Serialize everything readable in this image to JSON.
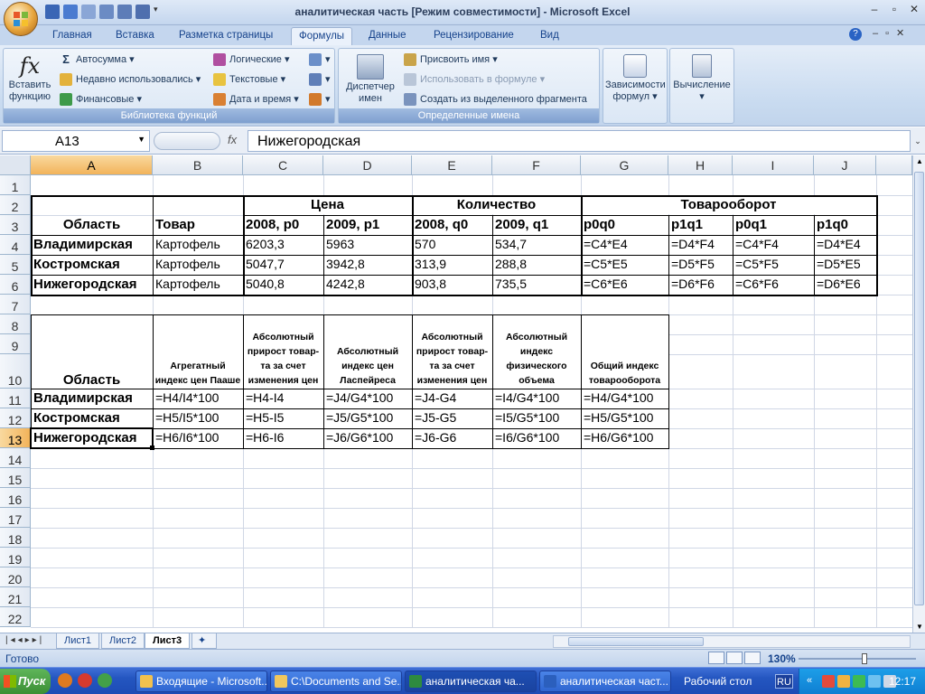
{
  "window": {
    "title": "аналитическая часть  [Режим совместимости] - Microsoft Excel"
  },
  "ribbon_tabs": [
    "Главная",
    "Вставка",
    "Разметка страницы",
    "Формулы",
    "Данные",
    "Рецензирование",
    "Вид"
  ],
  "ribbon": {
    "insert_function": [
      "Вставить",
      "функцию"
    ],
    "library": {
      "label": "Библиотека функций",
      "autosum": "Автосумма",
      "recent": "Недавно использовались",
      "financial": "Финансовые",
      "logical": "Логические",
      "text": "Текстовые",
      "datetime": "Дата и время"
    },
    "names": {
      "label": "Определенные имена",
      "manager": [
        "Диспетчер",
        "имен"
      ],
      "assign": "Присвоить имя",
      "use_in_formula": "Использовать в формуле",
      "create_from_selection": "Создать из выделенного фрагмента"
    },
    "dependencies": [
      "Зависимости",
      "формул"
    ],
    "calculation": "Вычисление"
  },
  "formula_bar": {
    "name_box": "A13",
    "fx": "fx",
    "value": "Нижегородская"
  },
  "columns": [
    "A",
    "B",
    "C",
    "D",
    "E",
    "F",
    "G",
    "H",
    "I",
    "J"
  ],
  "rows": [
    "1",
    "2",
    "3",
    "4",
    "5",
    "6",
    "7",
    "8",
    "9",
    "10",
    "11",
    "12",
    "13",
    "14",
    "15",
    "16",
    "17",
    "18",
    "19",
    "20",
    "21",
    "22"
  ],
  "table1": {
    "group_headers": {
      "price": "Цена",
      "quantity": "Количество",
      "turnover": "Товарооборот"
    },
    "headers": [
      "Область",
      "Товар",
      "2008,  p0",
      "2009,   p1",
      "2008,   q0",
      "2009,   q1",
      "p0q0",
      "p1q1",
      "p0q1",
      "p1q0"
    ],
    "rows": [
      [
        "Владимирская",
        "Картофель",
        "6203,3",
        "5963",
        "570",
        "534,7",
        "=C4*E4",
        "=D4*F4",
        "=C4*F4",
        "=D4*E4"
      ],
      [
        "Костромская",
        "Картофель",
        "5047,7",
        "3942,8",
        "313,9",
        "288,8",
        "=C5*E5",
        "=D5*F5",
        "=C5*F5",
        "=D5*E5"
      ],
      [
        "Нижегородская",
        "Картофель",
        "5040,8",
        "4242,8",
        "903,8",
        "735,5",
        "=C6*E6",
        "=D6*F6",
        "=C6*F6",
        "=D6*E6"
      ]
    ]
  },
  "table2": {
    "headers": [
      "Область",
      "Агрегатный индекс цен Пааше",
      "Абсолютный прирост товар-та за счет изменения цен",
      "Абсолютный индекс цен Ласпейреса",
      "Абсолютный прирост товар-та за счет изменения цен",
      "Абсолютный индекс физического объема",
      "Общий индекс товарооборота"
    ],
    "rows": [
      [
        "Владимирская",
        "=H4/I4*100",
        "=H4-I4",
        "=J4/G4*100",
        "=J4-G4",
        "=I4/G4*100",
        "=H4/G4*100"
      ],
      [
        "Костромская",
        "=H5/I5*100",
        "=H5-I5",
        "=J5/G5*100",
        "=J5-G5",
        "=I5/G5*100",
        "=H5/G5*100"
      ],
      [
        "Нижегородская",
        "=H6/I6*100",
        "=H6-I6",
        "=J6/G6*100",
        "=J6-G6",
        "=I6/G6*100",
        "=H6/G6*100"
      ]
    ]
  },
  "sheet_tabs": [
    "Лист1",
    "Лист2",
    "Лист3"
  ],
  "status": {
    "ready": "Готово",
    "zoom": "130%"
  },
  "taskbar": {
    "start": "Пуск",
    "buttons": [
      "Входящие - Microsoft...",
      "C:\\Documents and Se...",
      "аналитическая ча...",
      "аналитическая част...",
      "Рабочий стол"
    ],
    "lang": "RU",
    "clock": "12:17"
  },
  "colors": {
    "accent": "#15428b",
    "selected_header": "#f2b35a",
    "ribbon": "#c9dbf0",
    "taskbar": "#2456c0"
  }
}
